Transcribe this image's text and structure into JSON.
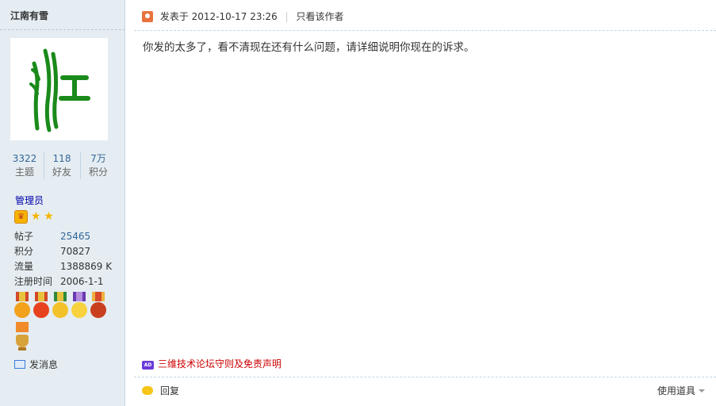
{
  "sidebar": {
    "username": "江南有雪",
    "stats": [
      {
        "value": "3322",
        "label": "主题"
      },
      {
        "value": "118",
        "label": "好友"
      },
      {
        "value": "7万",
        "label": "积分"
      }
    ],
    "group": "管理员",
    "info": [
      {
        "key": "帖子",
        "value": "25465",
        "link": true
      },
      {
        "key": "积分",
        "value": "70827",
        "link": false
      },
      {
        "key": "流量",
        "value": "1388869 K",
        "link": false
      },
      {
        "key": "注册时间",
        "value": "2006-1-1",
        "link": false
      }
    ],
    "send_message": "发消息"
  },
  "post": {
    "posted_at": "发表于 2012-10-17 23:26",
    "only_author": "只看该作者",
    "body": "你发的太多了，看不清现在还有什么问题，请详细说明你现在的诉求。",
    "ad_badge": "AD",
    "ad_text": "三维技术论坛守则及免责声明",
    "reply": "回复",
    "tools": "使用道具"
  },
  "colors": {
    "sidebar_bg": "#e5edf2",
    "link_blue": "#336699",
    "ad_red": "#cc0000",
    "avatar_green": "#1a8a1a"
  }
}
